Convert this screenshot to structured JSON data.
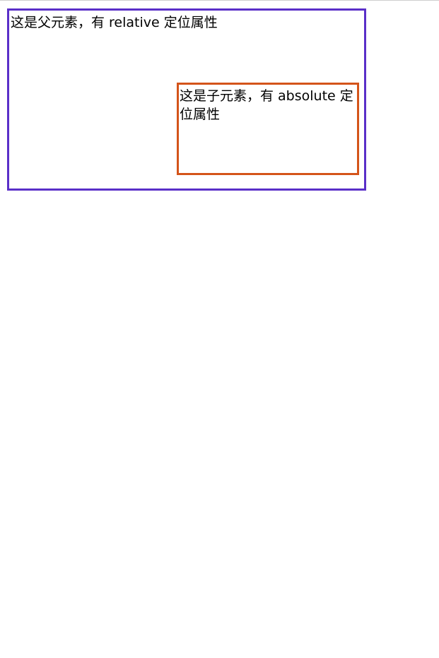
{
  "parent": {
    "text": "这是父元素，有 relative 定位属性",
    "border_color": "#5a2fc8"
  },
  "child": {
    "text": "这是子元素，有 absolute 定位属性",
    "border_color": "#d4541a"
  }
}
